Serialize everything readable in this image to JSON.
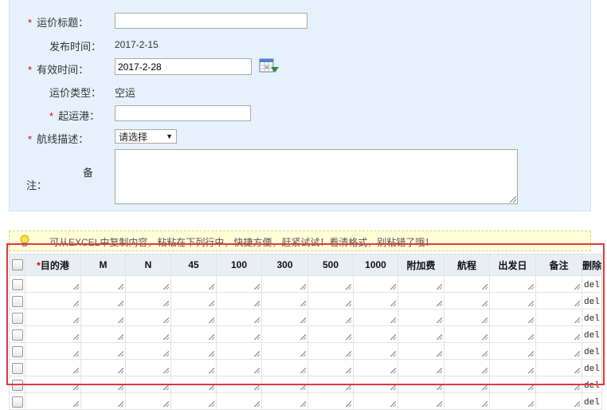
{
  "form": {
    "title_label": "运价标题：",
    "publish_label": "发布时间：",
    "publish_value": "2017-2-15",
    "valid_label": "有效时间：",
    "valid_value": "2017-2-28",
    "type_label": "运价类型：",
    "type_value": "空运",
    "origin_label": "起运港：",
    "route_label": "航线描述：",
    "route_select": "请选择",
    "remark_label_1": "备",
    "remark_label_2": "注：",
    "required_mark": "*"
  },
  "tip": {
    "text": "可从EXCEL中复制内容，粘粘在下列行中，快捷方便，赶紧试试！看清格式，别粘错了哦！"
  },
  "table": {
    "headers": [
      "*目的港",
      "M",
      "N",
      "45",
      "100",
      "300",
      "500",
      "1000",
      "附加费",
      "航程",
      "出发日",
      "备注",
      "删除"
    ],
    "delete_label": "del",
    "row_count": 8
  },
  "colors": {
    "panel_bg": "#e6f1fb",
    "required": "#d00",
    "highlight_frame": "#e0393b"
  }
}
